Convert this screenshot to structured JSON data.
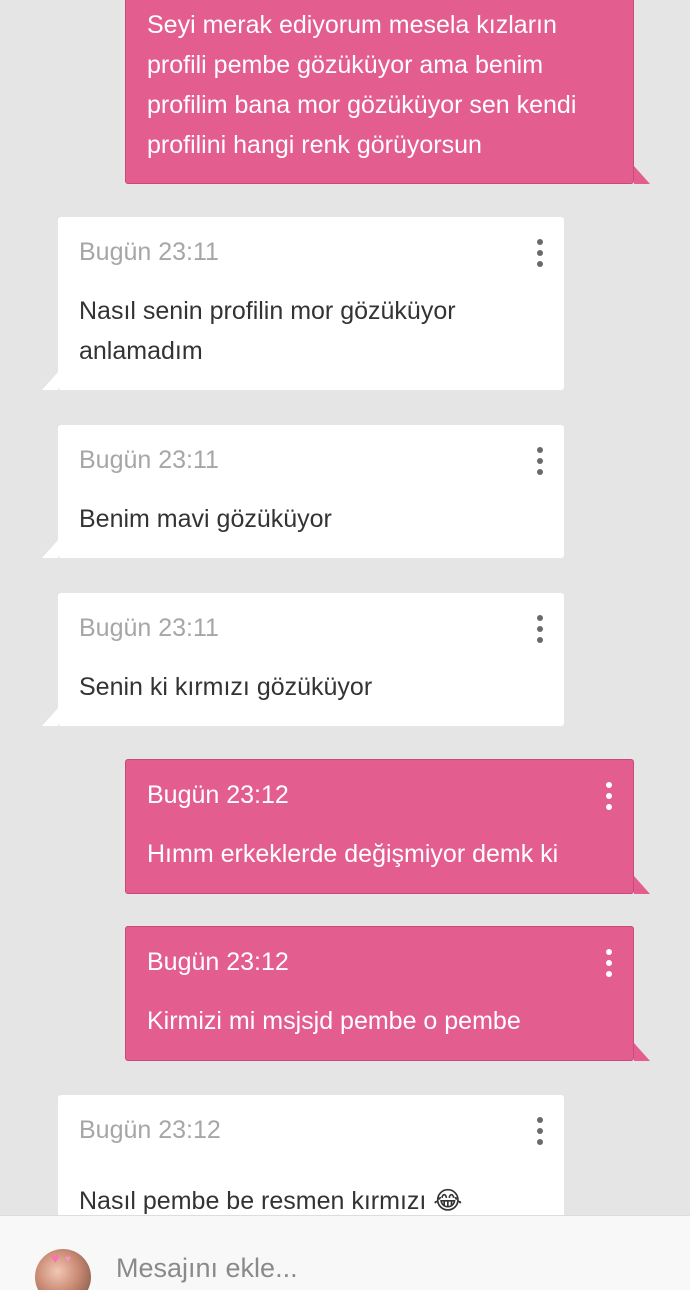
{
  "messages": [
    {
      "direction": "out",
      "time": "",
      "text": "Seyi merak ediyorum mesela kızların profili pembe gözüküyor ama benim profilim bana mor gözüküyor sen kendi profilini hangi renk görüyorsun"
    },
    {
      "direction": "in",
      "time": "Bugün 23:11",
      "text": "Nasıl senin profilin mor gözüküyor anlamadım"
    },
    {
      "direction": "in",
      "time": "Bugün 23:11",
      "text": "Benim mavi gözüküyor"
    },
    {
      "direction": "in",
      "time": "Bugün 23:11",
      "text": "Senin ki kırmızı gözüküyor"
    },
    {
      "direction": "out",
      "time": "Bugün 23:12",
      "text": "Hımm erkeklerde değişmiyor demk ki"
    },
    {
      "direction": "out",
      "time": "Bugün 23:12",
      "text": "Kirmizi mi msjsjd pembe o pembe"
    },
    {
      "direction": "in",
      "time": "Bugün 23:12",
      "text": "Nasıl pembe be resmen kırmızı 😂"
    }
  ],
  "composer": {
    "placeholder": "Mesajını ekle..."
  },
  "colors": {
    "background": "#e5e5e5",
    "outgoing_bubble": "#e35d8e",
    "incoming_bubble": "#ffffff",
    "timestamp_incoming": "#a6a6a6"
  },
  "icons": {
    "message_menu": "more-vertical-icon",
    "avatar": "user-avatar"
  }
}
